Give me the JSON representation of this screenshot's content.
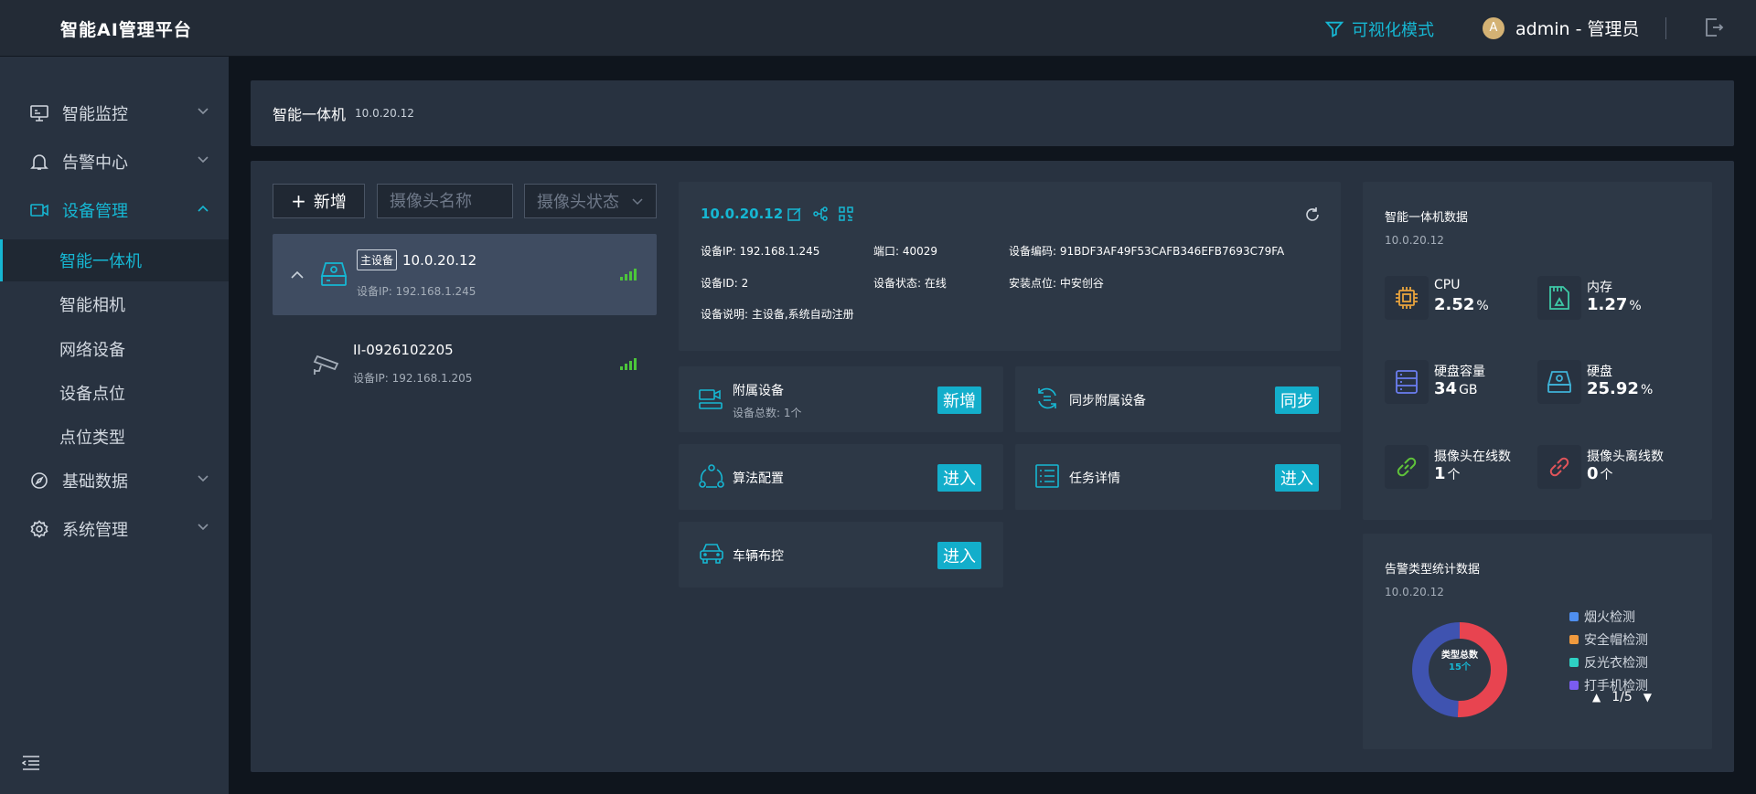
{
  "app": {
    "title": "智能AI管理平台",
    "viz_mode": "可视化模式",
    "user_initial": "A",
    "user_label": "admin - 管理员"
  },
  "sidebar": {
    "menus": [
      {
        "label": "智能监控",
        "icon": "monitor-icon"
      },
      {
        "label": "告警中心",
        "icon": "bell-icon"
      },
      {
        "label": "设备管理",
        "icon": "camera-device-icon"
      },
      {
        "label": "基础数据",
        "icon": "compass-icon"
      },
      {
        "label": "系统管理",
        "icon": "gear-icon"
      }
    ],
    "sub_items": [
      "智能一体机",
      "智能相机",
      "网络设备",
      "设备点位",
      "点位类型"
    ]
  },
  "header": {
    "title": "智能一体机",
    "ip": "10.0.20.12"
  },
  "toolbar": {
    "add_label": "新增",
    "name_placeholder": "摄像头名称",
    "status_placeholder": "摄像头状态"
  },
  "devices": [
    {
      "tag": "主设备",
      "name": "10.0.20.12",
      "ip_label": "设备IP:  192.168.1.245"
    },
    {
      "name": "II-0926102205",
      "ip_label": "设备IP:  192.168.1.205"
    }
  ],
  "device_info": {
    "ip": "10.0.20.12",
    "device_ip": "设备IP:  192.168.1.245",
    "port": "端口:  40029",
    "code": "设备编码:  91BDF3AF49F53CAFB346EFB7693C79FA",
    "device_id": "设备ID:  2",
    "status": "设备状态:  在线",
    "location": "安装点位:  中安创谷",
    "desc": "设备说明:  主设备,系统自动注册"
  },
  "actions": {
    "attached": {
      "title": "附属设备",
      "sub": "设备总数: 1个",
      "btn": "新增"
    },
    "sync": {
      "title": "同步附属设备",
      "btn": "同步"
    },
    "algo": {
      "title": "算法配置",
      "btn": "进入"
    },
    "task": {
      "title": "任务详情",
      "btn": "进入"
    },
    "vehicle": {
      "title": "车辆布控",
      "btn": "进入"
    }
  },
  "stats": {
    "title": "智能一体机数据",
    "sub": "10.0.20.12",
    "items": [
      {
        "label": "CPU",
        "value": "2.52",
        "unit": "%",
        "icon": "chip-icon",
        "color": "#e8a33d"
      },
      {
        "label": "内存",
        "value": "1.27",
        "unit": "%",
        "icon": "memory-card-icon",
        "color": "#3ec9a7"
      },
      {
        "label": "硬盘容量",
        "value": "34",
        "unit": "GB",
        "icon": "server-icon",
        "color": "#6b7df0"
      },
      {
        "label": "硬盘",
        "value": "25.92",
        "unit": "%",
        "icon": "disk-icon",
        "color": "#3fb3d8"
      },
      {
        "label": "摄像头在线数",
        "value": "1",
        "unit": "个",
        "icon": "link-icon",
        "color": "#5fc23a"
      },
      {
        "label": "摄像头离线数",
        "value": "0",
        "unit": "个",
        "icon": "link-broken-icon",
        "color": "#e0545a"
      }
    ]
  },
  "alarm": {
    "title": "告警类型统计数据",
    "sub": "10.0.20.12",
    "center_label": "类型总数",
    "center_value": "15个",
    "legend": [
      {
        "label": "烟火检测",
        "color": "#4f8ff0"
      },
      {
        "label": "安全帽检测",
        "color": "#f09a3e"
      },
      {
        "label": "反光衣检测",
        "color": "#2ed1c4"
      },
      {
        "label": "打手机检测",
        "color": "#7b5cf0"
      }
    ],
    "page": "1/5",
    "segments": [
      {
        "color": "#e84450",
        "value": 7.6
      },
      {
        "color": "#3f53b0",
        "value": 7.4
      }
    ]
  }
}
